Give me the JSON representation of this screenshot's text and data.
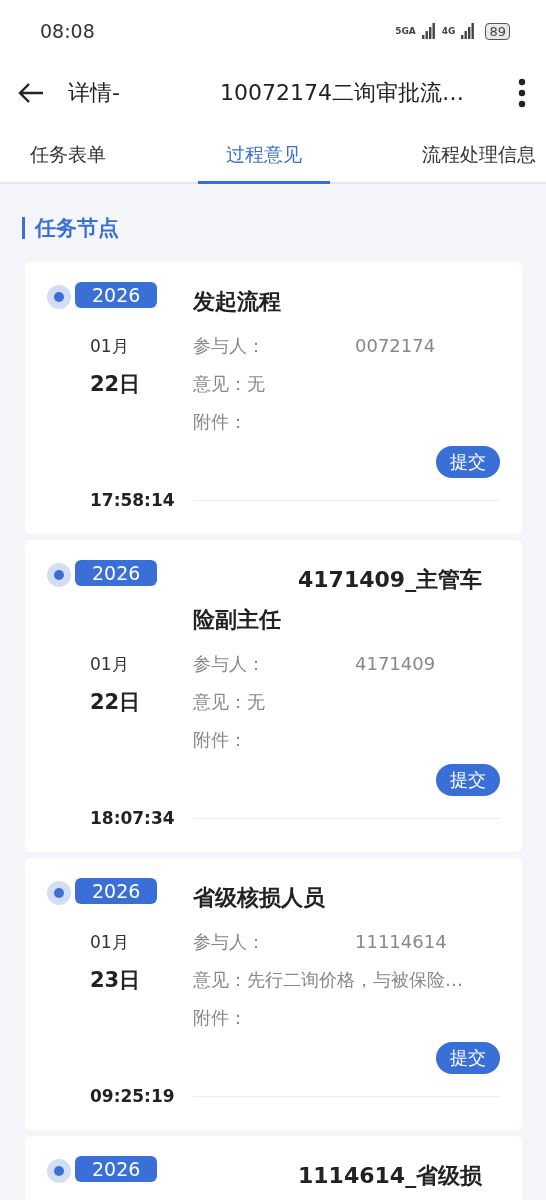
{
  "status_bar": {
    "time": "08:08",
    "networks": [
      "5GA",
      "4G"
    ],
    "battery": "89"
  },
  "header": {
    "title_parts": [
      "详情-",
      "10072174二询审批流…"
    ]
  },
  "tabs": [
    {
      "label": "任务表单",
      "selected": false
    },
    {
      "label": "过程意见",
      "selected": true
    },
    {
      "label": "流程处理信息",
      "selected": false
    }
  ],
  "section_title": "任务节点",
  "nodes": [
    {
      "year": "2026",
      "month": "01月",
      "day": "22日",
      "time": "17:58:14",
      "title_redacted": false,
      "title_lines": [
        "发起流程"
      ],
      "participant_label": "参与人：",
      "participant_redacted": true,
      "participant": "0072174",
      "opinion_label": "意见：",
      "opinion": "无",
      "attachment_label": "附件：",
      "action": "提交"
    },
    {
      "year": "2026",
      "month": "01月",
      "day": "22日",
      "time": "18:07:34",
      "title_redacted": true,
      "title_lines": [
        "4171409_主管车",
        "险副主任"
      ],
      "participant_label": "参与人：",
      "participant_redacted": true,
      "participant": "4171409",
      "opinion_label": "意见：",
      "opinion": "无",
      "attachment_label": "附件：",
      "action": "提交"
    },
    {
      "year": "2026",
      "month": "01月",
      "day": "23日",
      "time": "09:25:19",
      "title_redacted": false,
      "title_lines": [
        "省级核损人员"
      ],
      "participant_label": "参与人：",
      "participant_redacted": true,
      "participant": "11114614",
      "opinion_label": "意见：",
      "opinion": "先行二询价格，与被保险…",
      "attachment_label": "附件：",
      "action": "提交"
    },
    {
      "year": "2026",
      "title_redacted": true,
      "title_lines": [
        "1114614_省级损"
      ]
    }
  ]
}
